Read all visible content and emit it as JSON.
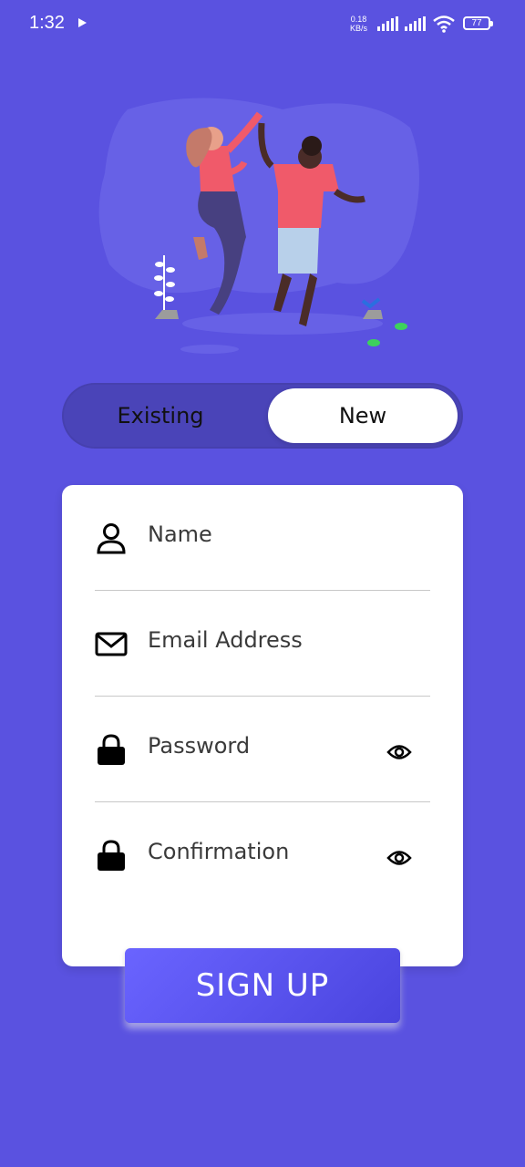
{
  "status": {
    "time": "1:32",
    "net_speed_value": "0.18",
    "net_speed_unit": "KB/s",
    "battery": "77"
  },
  "toggle": {
    "existing": "Existing",
    "new": "New",
    "selected": "New"
  },
  "form": {
    "name": "Name",
    "email": "Email Address",
    "password": "Password",
    "confirmation": "Confirmation"
  },
  "signup_label": "SIGN UP",
  "colors": {
    "background": "#5a52e0",
    "toggle_track": "#4a44b8",
    "button": "#5a52e8"
  }
}
